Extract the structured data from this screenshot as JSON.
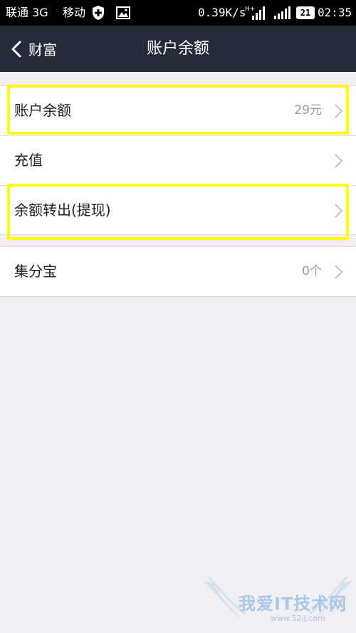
{
  "status_bar": {
    "carrier1": "联通 3G",
    "carrier2": "移动",
    "speed": "0.39K/s",
    "network": "H+",
    "battery": "21",
    "time": "02:35"
  },
  "nav": {
    "back_label": "财富",
    "title": "账户余额"
  },
  "rows_group1": [
    {
      "label": "账户余额",
      "value": "29元"
    },
    {
      "label": "充值",
      "value": ""
    },
    {
      "label": "余额转出(提现)",
      "value": ""
    }
  ],
  "rows_group2": [
    {
      "label": "集分宝",
      "value": "0个"
    }
  ],
  "watermark": {
    "text": "我爱IT技术网",
    "sub": "www.52ij.com"
  },
  "colors": {
    "nav_bg": "#262b3a",
    "highlight": "#ffff00",
    "page_bg": "#efeff4"
  }
}
